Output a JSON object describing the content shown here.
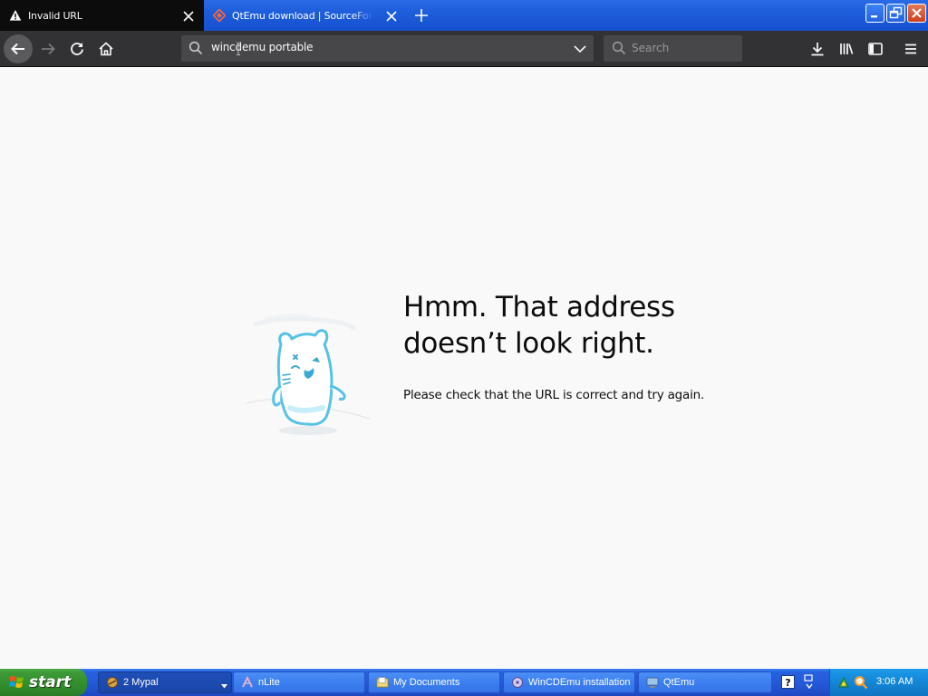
{
  "browser": {
    "tabs": [
      {
        "title": "Invalid URL",
        "icon": "warning-icon",
        "active": true
      },
      {
        "title": "QtEmu download | SourceForge.net",
        "icon": "sourceforge-icon",
        "active": false
      }
    ],
    "url": "wincdemu portable",
    "search_placeholder": "Search"
  },
  "error_page": {
    "title": "Hmm. That address doesn’t look right.",
    "description": "Please check that the URL is correct and try again."
  },
  "taskbar": {
    "start_label": "start",
    "tasks": [
      {
        "label": "2 Mypal",
        "icon": "mypal-icon",
        "active": true
      },
      {
        "label": "nLite",
        "icon": "nlite-icon",
        "active": false
      },
      {
        "label": "My Documents",
        "icon": "folder-icon",
        "active": false
      },
      {
        "label": "WinCDEmu installation",
        "icon": "installer-icon",
        "active": false
      },
      {
        "label": "QtEmu",
        "icon": "qtemu-icon",
        "active": false
      }
    ],
    "clock": "3:06 AM"
  },
  "colors": {
    "tab_strip": "#1f5fdc",
    "active_tab": "#0c0c0d",
    "nav_bar": "#323234",
    "page_background": "#f9f9fa",
    "start_button": "#3d9a35",
    "taskbar": "#2457d6",
    "tray": "#1386d6"
  }
}
